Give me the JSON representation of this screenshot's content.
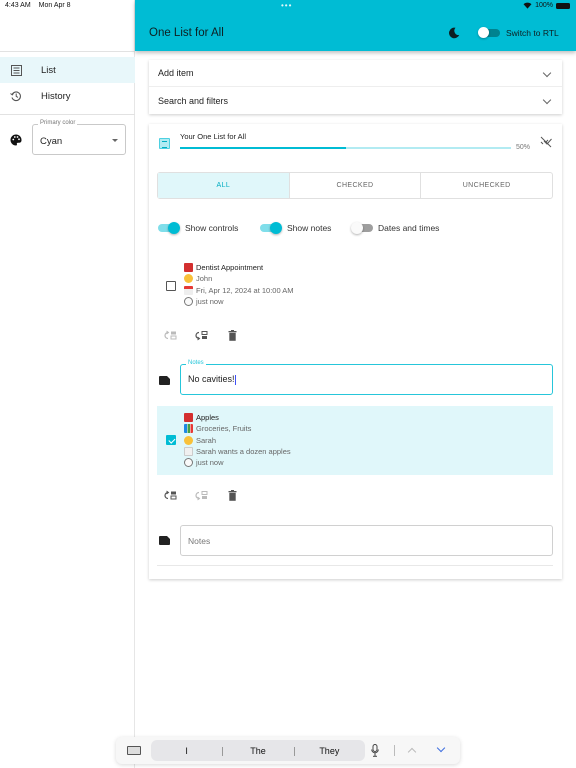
{
  "status_bar": {
    "time": "4:43 AM",
    "date": "Mon Apr 8",
    "battery": "100%"
  },
  "appbar": {
    "title": "One List for All",
    "theme_icon": "moon-icon",
    "rtl_label": "Switch to RTL",
    "rtl_on": false
  },
  "sidebar": {
    "items": [
      {
        "label": "List",
        "icon": "list-icon",
        "active": true
      },
      {
        "label": "History",
        "icon": "history-icon",
        "active": false
      }
    ],
    "primary_color": {
      "label": "Primary color",
      "value": "Cyan"
    }
  },
  "accordions": [
    {
      "label": "Add item"
    },
    {
      "label": "Search and filters"
    }
  ],
  "list": {
    "title": "Your One List for All",
    "progress_percent": 50,
    "progress_label": "50%",
    "tabs": [
      {
        "label": "ALL",
        "active": true
      },
      {
        "label": "CHECKED",
        "active": false
      },
      {
        "label": "UNCHECKED",
        "active": false
      }
    ],
    "switches": [
      {
        "label": "Show controls",
        "on": true
      },
      {
        "label": "Show notes",
        "on": true
      },
      {
        "label": "Dates and times",
        "on": false
      }
    ],
    "items": [
      {
        "checked": false,
        "title": "Dentist Appointment",
        "assignee": "John",
        "date": "Fri, Apr 12, 2024 at 10:00 AM",
        "updated": "just now",
        "notes_label": "Notes",
        "notes_value": "No cavities!"
      },
      {
        "checked": true,
        "title": "Apples",
        "categories": "Groceries, Fruits",
        "assignee": "Sarah",
        "note": "Sarah wants a dozen apples",
        "updated": "just now",
        "notes_placeholder": "Notes"
      }
    ]
  },
  "keyboard_bar": {
    "suggestions": [
      "I",
      "The",
      "They"
    ]
  },
  "colors": {
    "primary": "#00bcd4",
    "accent_light": "#e0f7fa",
    "progress_track": "#b2ebf2"
  }
}
